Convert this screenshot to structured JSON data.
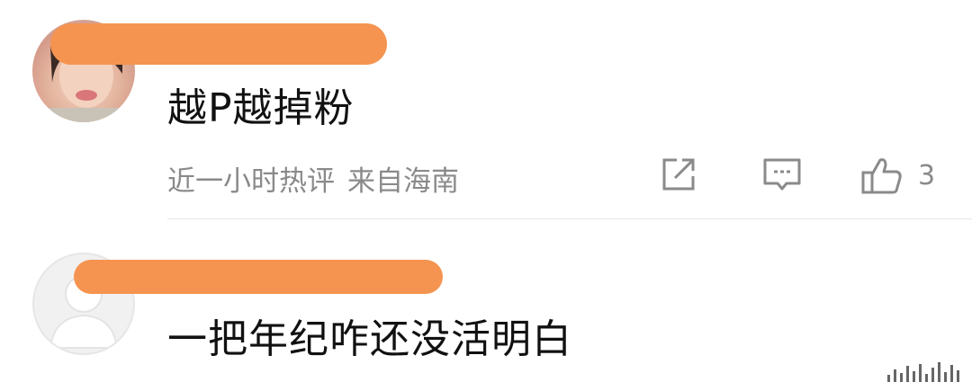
{
  "comments": [
    {
      "text": "越P越掉粉",
      "time": "近一小时热评",
      "location": "来自海南",
      "like_count": "3"
    },
    {
      "text": "一把年纪咋还没活明白"
    }
  ],
  "colors": {
    "redaction": "#f59450",
    "text": "#111111",
    "meta": "#8a8a8a",
    "icon": "#8a8a8a"
  },
  "icons": {
    "share": "share-icon",
    "reply": "comment-icon",
    "like": "thumbs-up-icon"
  }
}
